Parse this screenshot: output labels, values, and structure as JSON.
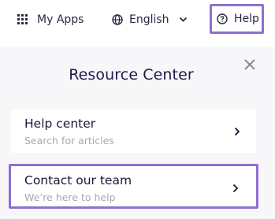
{
  "topbar": {
    "apps": {
      "label": "My Apps",
      "icon": "grid-icon"
    },
    "language": {
      "label": "English",
      "icon": "globe-icon"
    },
    "help": {
      "label": "Help",
      "icon": "question-circle-icon"
    }
  },
  "panel": {
    "title": "Resource Center",
    "items": [
      {
        "title": "Help center",
        "subtitle": "Search for articles"
      },
      {
        "title": "Contact our team",
        "subtitle": "We’re here to help"
      }
    ]
  },
  "colors": {
    "highlight": "#8e6fd1",
    "text": "#1e1a3c",
    "muted": "#a8a8b4",
    "panel_bg": "#f7f7f9"
  }
}
